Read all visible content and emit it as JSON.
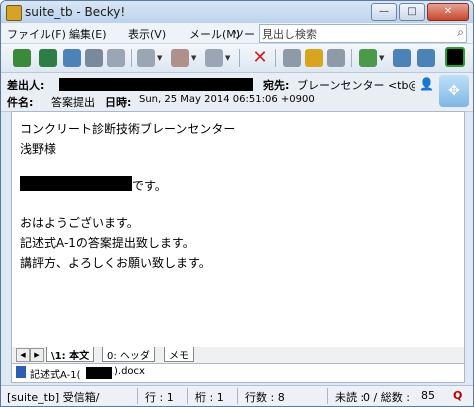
{
  "window": {
    "title": "suite_tb - Becky!"
  },
  "menu": {
    "items": [
      "ファイル(F)",
      "編集(E)",
      "表示(V)",
      "メール(M)",
      "ツー"
    ],
    "search_placeholder": "見出し検索"
  },
  "toolbar": {
    "icons": [
      "check-mail-icon",
      "send-mail-icon",
      "receive-icon",
      "print-icon",
      "compose-icon",
      "reply-icon",
      "forward-icon",
      "delete-icon",
      "address-book-icon",
      "edit-icon",
      "filter-icon",
      "plugin-icon",
      "tools-icon",
      "status-icon"
    ]
  },
  "header": {
    "from_label": "差出人:",
    "to_label": "宛先:",
    "to_value": "ブレーンセンター <tb@brain-c",
    "subject_label": "件名:",
    "subject_value": "答案提出",
    "date_label": "日時:",
    "date_value": "Sun, 25 May 2014 06:51:06 +0900"
  },
  "body": {
    "lines": [
      "コンクリート診断技術ブレーンセンター",
      "浅野様",
      "",
      "です。",
      "",
      "おはようございます。",
      "記述式A-1の答案提出致します。",
      "講評方、よろしくお願い致します。"
    ]
  },
  "tabs": {
    "items": [
      "\\1: 本文",
      "0: ヘッダ",
      "メモ"
    ]
  },
  "attachment": {
    "prefix": "記述式A-1(",
    "suffix": ").docx"
  },
  "status": {
    "folder": "[suite_tb] 受信箱/",
    "line": "行 : 1",
    "col": "桁 : 1",
    "lines_count": "行数 : 8",
    "unread_label": "未読 :",
    "unread_value": "0 / 総数 :",
    "total_value": "85"
  },
  "colors": {
    "accent": "#c00000"
  }
}
